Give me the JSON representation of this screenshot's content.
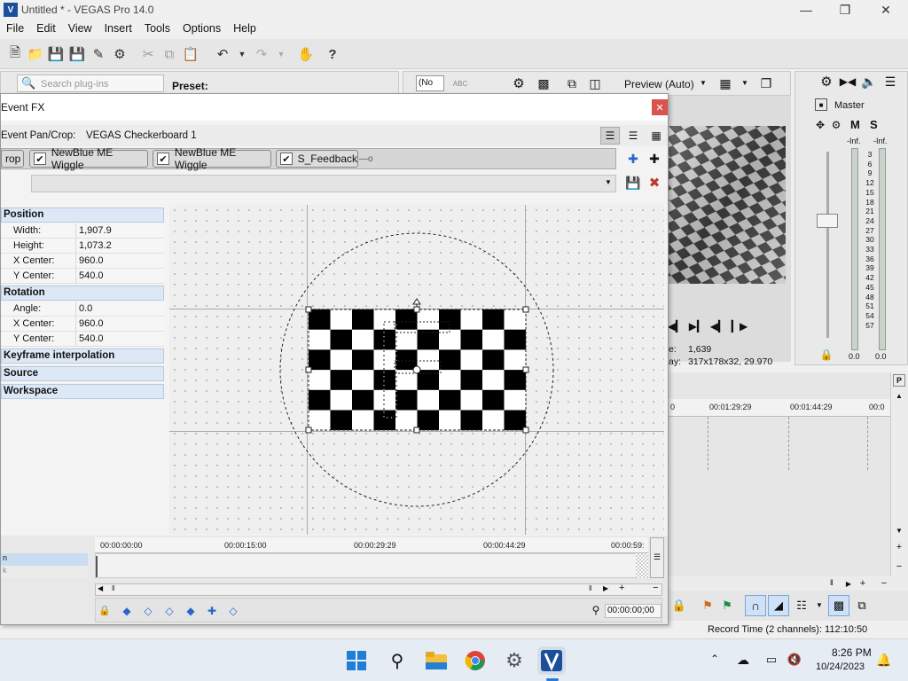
{
  "window": {
    "title": "Untitled * - VEGAS Pro 14.0"
  },
  "menu": [
    "File",
    "Edit",
    "View",
    "Insert",
    "Tools",
    "Options",
    "Help"
  ],
  "plugin_panel": {
    "search_placeholder": "Search plug-ins",
    "preset_label": "Preset:"
  },
  "preview": {
    "dropdown_value": "(No",
    "quality": "Preview (Auto)",
    "frame_info": "1,639",
    "display_info": "317x178x32, 29.970",
    "frame_prefix": "e:",
    "display_prefix": "ay:"
  },
  "mixer": {
    "master": "Master",
    "m": "M",
    "s": "S",
    "inf_left": "-Inf.",
    "inf_right": "-Inf.",
    "scale": [
      "3",
      "6",
      "9",
      "12",
      "15",
      "18",
      "21",
      "24",
      "27",
      "30",
      "33",
      "36",
      "39",
      "42",
      "45",
      "48",
      "51",
      "54",
      "57"
    ],
    "bottom_left": "0.0",
    "bottom_right": "0.0"
  },
  "timeline_right": {
    "times": [
      "0",
      "00:01:29:29",
      "00:01:44:29",
      "00:0"
    ]
  },
  "fx": {
    "title": "Event FX",
    "chain_label": "Event Pan/Crop:",
    "chain_value": "VEGAS Checkerboard 1",
    "tabs": [
      "rop",
      "NewBlue ME Wiggle",
      "NewBlue ME Wiggle",
      "S_Feedback"
    ],
    "sections": {
      "position": "Position",
      "rotation": "Rotation",
      "keyframe": "Keyframe interpolation",
      "source": "Source",
      "workspace": "Workspace"
    },
    "position_rows": [
      {
        "label": "Width:",
        "value": "1,907.9"
      },
      {
        "label": "Height:",
        "value": "1,073.2"
      },
      {
        "label": "X Center:",
        "value": "960.0"
      },
      {
        "label": "Y Center:",
        "value": "540.0"
      }
    ],
    "rotation_rows": [
      {
        "label": "Angle:",
        "value": "0.0"
      },
      {
        "label": "X Center:",
        "value": "960.0"
      },
      {
        "label": "Y Center:",
        "value": "540.0"
      }
    ],
    "timeline": {
      "times": [
        "00:00:00:00",
        "00:00:15:00",
        "00:00:29:29",
        "00:00:44:29",
        "00:00:59:"
      ],
      "track_labels": [
        "n",
        "k"
      ],
      "cursor_time": "00:00:00;00"
    }
  },
  "status": {
    "record_time": "Record Time (2 channels): 112:10:50"
  },
  "taskbar": {
    "time": "8:26 PM",
    "date": "10/24/2023"
  },
  "colors": {
    "accent": "#2a66c9",
    "close_red": "#d9534f"
  }
}
